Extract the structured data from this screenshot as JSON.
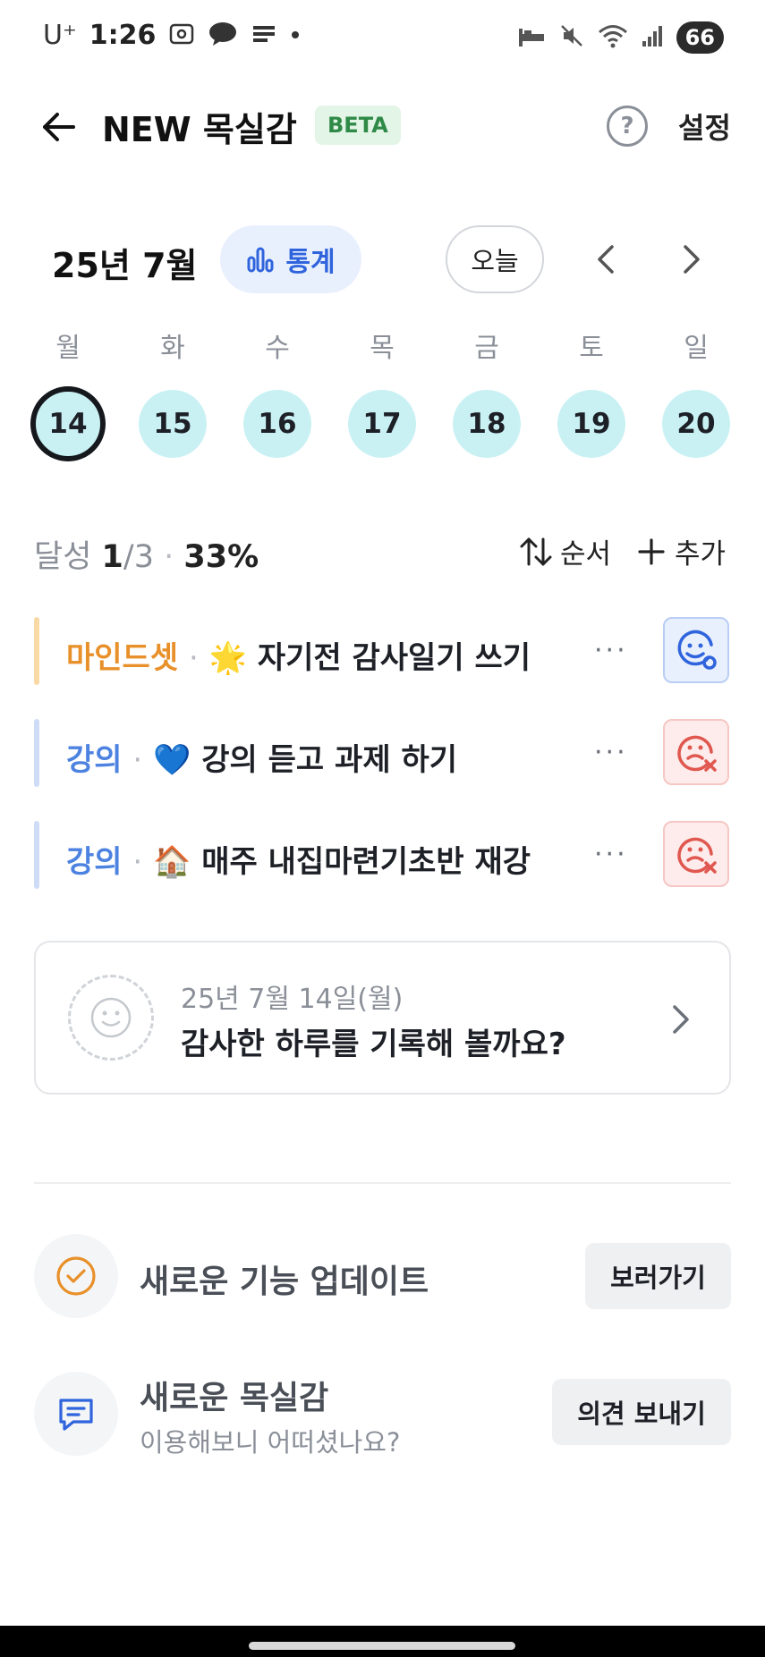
{
  "status_bar": {
    "carrier": "U⁺",
    "time": "1:26",
    "battery": "66"
  },
  "header": {
    "title": "NEW 목실감",
    "badge": "BETA",
    "help_icon": "?",
    "settings_label": "설정"
  },
  "calendar": {
    "month_label": "25년 7월",
    "stats_label": "통계",
    "today_label": "오늘",
    "weekdays": [
      "월",
      "화",
      "수",
      "목",
      "금",
      "토",
      "일"
    ],
    "days": [
      "14",
      "15",
      "16",
      "17",
      "18",
      "19",
      "20"
    ],
    "selected_day": "14"
  },
  "progress": {
    "label": "달성",
    "done": "1",
    "total": "/3",
    "sep": "·",
    "percent": "33%",
    "order_label": "순서",
    "add_label": "추가"
  },
  "goals": [
    {
      "category": "마인드셋",
      "sep": "·",
      "emoji": "🌟",
      "title": "자기전 감사일기 쓰기",
      "more": "···",
      "state": "achieved",
      "state_icon": "smile-check-icon",
      "bar_color": "#f9d9a6"
    },
    {
      "category": "강의",
      "sep": "·",
      "emoji": "💙",
      "title": "강의 듣고 과제 하기",
      "more": "···",
      "state": "not-achieved",
      "state_icon": "sad-x-icon",
      "bar_color": "#cfdcf7"
    },
    {
      "category": "강의",
      "sep": "·",
      "emoji": "🏠",
      "title": "매주 내집마련기초반 재강",
      "more": "···",
      "state": "not-achieved",
      "state_icon": "sad-x-icon",
      "bar_color": "#cfdcf7"
    }
  ],
  "diary": {
    "date": "25년 7월 14일(월)",
    "prompt": "감사한 하루를 기록해 볼까요?"
  },
  "bottom": {
    "update": {
      "title": "새로운 기능 업데이트",
      "button": "보러가기"
    },
    "feedback": {
      "title": "새로운 목실감",
      "subtitle": "이용해보니 어떠셨나요?",
      "button": "의견 보내기"
    }
  },
  "colors": {
    "accent_blue": "#2f64dd",
    "day_bg": "#c9f1f4",
    "beta_bg": "#e3f5e6",
    "beta_text": "#2f8a48",
    "orange": "#e8902a",
    "red": "#e0574f"
  }
}
